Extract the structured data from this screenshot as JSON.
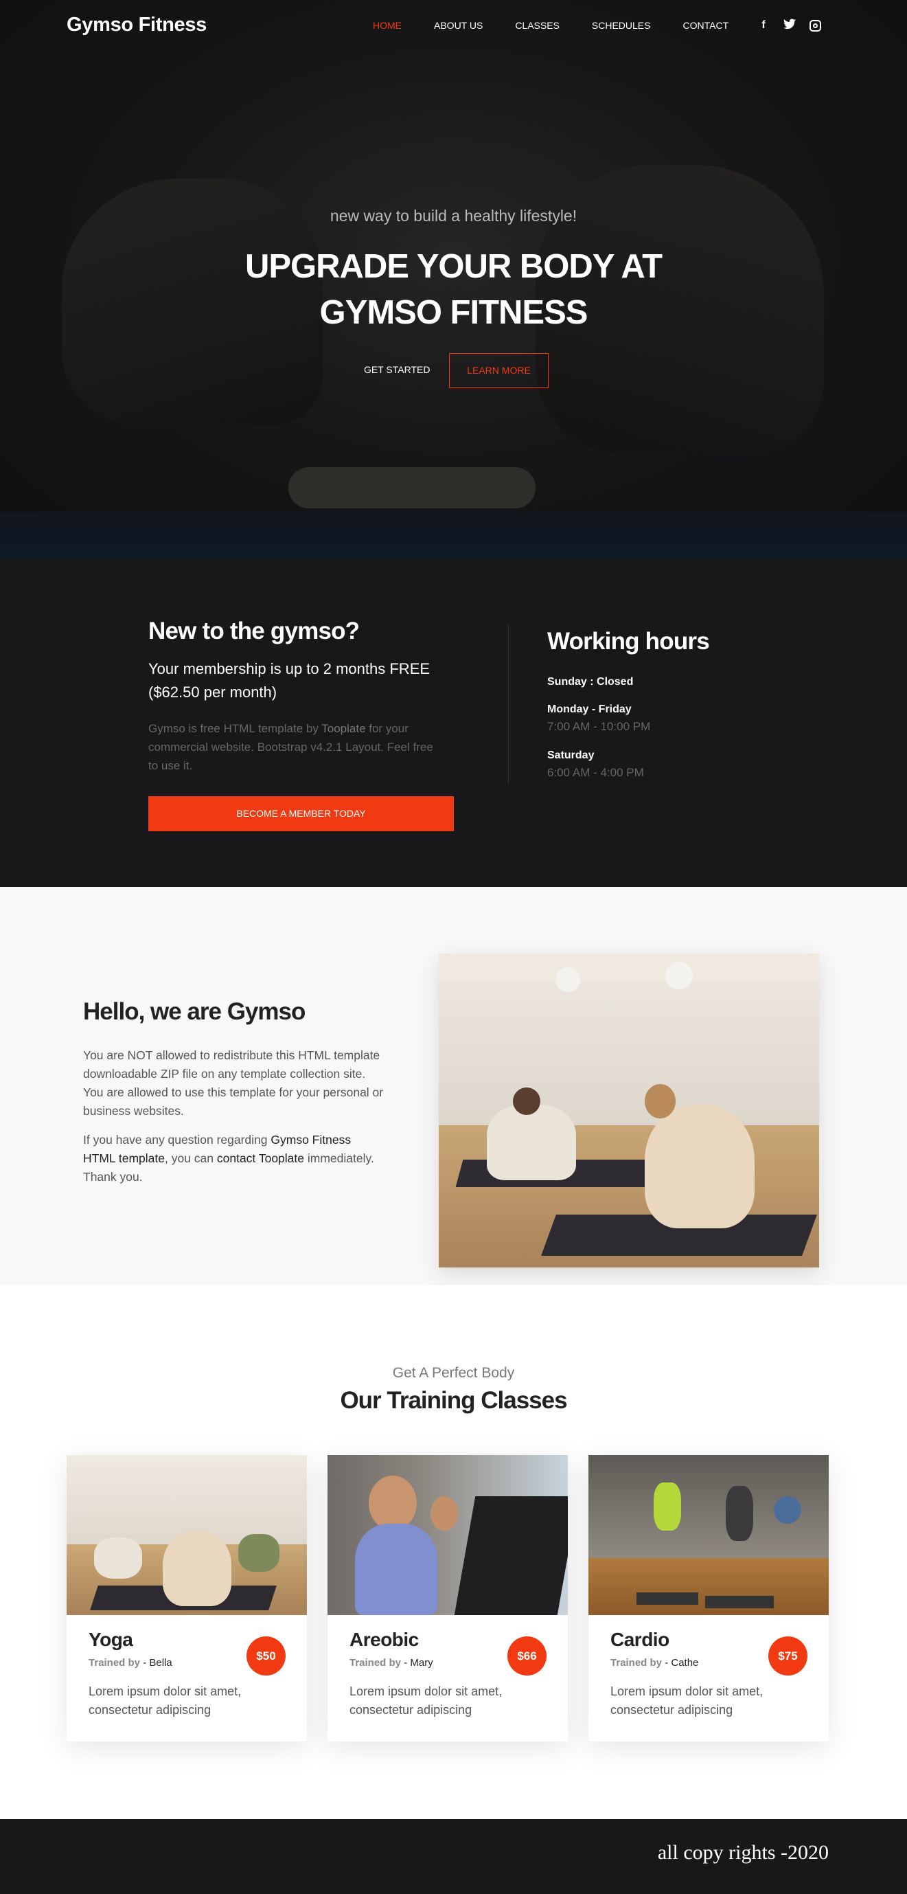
{
  "nav": {
    "brand": "Gymso Fitness",
    "items": [
      {
        "label": "HOME",
        "active": true
      },
      {
        "label": "ABOUT US"
      },
      {
        "label": "CLASSES"
      },
      {
        "label": "SCHEDULES"
      },
      {
        "label": "CONTACT"
      }
    ],
    "social": [
      "facebook-icon",
      "twitter-icon",
      "instagram-icon"
    ]
  },
  "hero": {
    "subtitle": "new way to build a healthy lifestyle!",
    "title": "UPGRADE YOUR BODY AT GYMSO FITNESS",
    "primary_button": "GET STARTED",
    "secondary_button": "LEARN MORE"
  },
  "membership": {
    "title": "New to the gymso?",
    "subtitle": "Your membership is up to 2 months FREE ($62.50 per month)",
    "desc_before": "Gymso is free HTML template by ",
    "desc_link": "Tooplate",
    "desc_after": " for your commercial website. Bootstrap v4.2.1 Layout. Feel free to use it.",
    "button": "BECOME A MEMBER TODAY"
  },
  "hours": {
    "title": "Working hours",
    "rows": [
      {
        "day": "Sunday : Closed",
        "time": ""
      },
      {
        "day": "Monday - Friday",
        "time": "7:00 AM - 10:00 PM"
      },
      {
        "day": "Saturday",
        "time": "6:00 AM - 4:00 PM"
      }
    ]
  },
  "about": {
    "title": "Hello, we are Gymso",
    "p1": "You are NOT allowed to redistribute this HTML template downloadable ZIP file on any template collection site. You are allowed to use this template for your personal or business websites.",
    "p2_a": "If you have any question regarding ",
    "p2_b": "Gymso Fitness HTML template",
    "p2_c": ", you can ",
    "p2_d": "contact Tooplate",
    "p2_e": " immediately. Thank you."
  },
  "classes": {
    "subtitle": "Get A Perfect Body",
    "title": "Our Training Classes",
    "cards": [
      {
        "name": "Yoga",
        "trained_by": "Trained by",
        "trainer": " - Bella",
        "price": "$50",
        "desc": "Lorem ipsum dolor sit amet, consectetur adipiscing"
      },
      {
        "name": "Areobic",
        "trained_by": "Trained by",
        "trainer": " - Mary",
        "price": "$66",
        "desc": "Lorem ipsum dolor sit amet, consectetur adipiscing"
      },
      {
        "name": "Cardio",
        "trained_by": "Trained by",
        "trainer": " - Cathe",
        "price": "$75",
        "desc": "Lorem ipsum dolor sit amet, consectetur adipiscing"
      }
    ]
  },
  "footer": {
    "copyright": "all copy rights -2020"
  },
  "colors": {
    "accent": "#f13a11",
    "dark_bg": "#18181b",
    "light_bg": "#f8f8f8"
  }
}
